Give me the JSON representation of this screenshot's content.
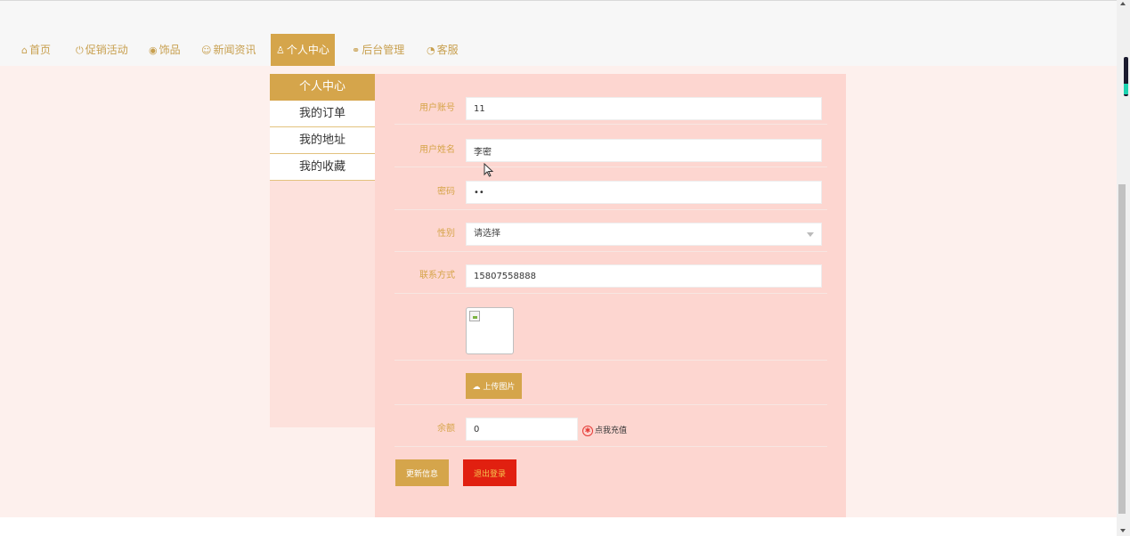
{
  "nav": {
    "items": [
      {
        "label": "首页",
        "icon": "home-icon",
        "glyph": "⌂"
      },
      {
        "label": "促销活动",
        "icon": "power-icon",
        "glyph": "⏻"
      },
      {
        "label": "饰品",
        "icon": "gem-icon",
        "glyph": "◉"
      },
      {
        "label": "新闻资讯",
        "icon": "news-icon",
        "glyph": "☺"
      },
      {
        "label": "个人中心",
        "icon": "user-icon",
        "glyph": "♙"
      },
      {
        "label": "后台管理",
        "icon": "link-icon",
        "glyph": "🔗"
      },
      {
        "label": "客服",
        "icon": "chat-icon",
        "glyph": "◔"
      }
    ],
    "active": "个人中心"
  },
  "sidebar": {
    "title": "个人中心",
    "items": [
      {
        "label": "我的订单"
      },
      {
        "label": "我的地址"
      },
      {
        "label": "我的收藏"
      }
    ]
  },
  "form": {
    "account": {
      "label": "用户账号",
      "value": "11"
    },
    "name": {
      "label": "用户姓名",
      "value": "李密"
    },
    "password": {
      "label": "密码",
      "value": "••"
    },
    "gender": {
      "label": "性别",
      "value": "请选择"
    },
    "contact": {
      "label": "联系方式",
      "value": "15807558888"
    },
    "upload_label": "上传图片",
    "balance": {
      "label": "余额",
      "value": "0"
    },
    "recharge_label": "点我充值",
    "update_label": "更新信息",
    "logout_label": "退出登录"
  },
  "colors": {
    "accent": "#d5a54b",
    "danger": "#e12010",
    "panel": "#fdd6d0"
  }
}
